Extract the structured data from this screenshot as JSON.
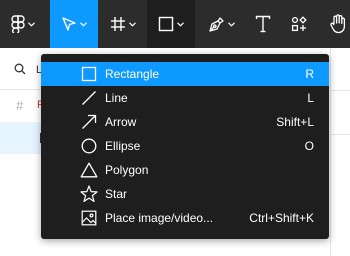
{
  "colors": {
    "toolbar_bg": "#2c2c2c",
    "selected_tool_bg": "#0d99ff",
    "pressed_tool_bg": "#1e1e1e",
    "menu_bg": "#1e1e1e",
    "menu_highlight": "#0d99ff"
  },
  "toolbar": {
    "tools": [
      {
        "icon": "figma-main-menu-icon",
        "has_dropdown": true,
        "state": "normal"
      },
      {
        "icon": "move-cursor-icon",
        "has_dropdown": true,
        "state": "selected"
      },
      {
        "icon": "frame-hash-icon",
        "has_dropdown": true,
        "state": "normal"
      },
      {
        "icon": "rectangle-shape-icon",
        "has_dropdown": true,
        "state": "pressed"
      },
      {
        "icon": "pen-tool-icon",
        "has_dropdown": true,
        "state": "normal"
      },
      {
        "icon": "text-tool-icon",
        "has_dropdown": false,
        "state": "normal"
      },
      {
        "icon": "resources-icon",
        "has_dropdown": false,
        "state": "normal"
      },
      {
        "icon": "hand-tool-icon",
        "has_dropdown": false,
        "state": "normal"
      }
    ]
  },
  "background": {
    "search_text": "L",
    "layer_initial": "F",
    "search_icon": "search-icon",
    "frame_icon": "#"
  },
  "shape_menu": {
    "items": [
      {
        "label": "Rectangle",
        "shortcut": "R",
        "icon": "rectangle-icon",
        "highlighted": true
      },
      {
        "label": "Line",
        "shortcut": "L",
        "icon": "line-icon",
        "highlighted": false
      },
      {
        "label": "Arrow",
        "shortcut": "Shift+L",
        "icon": "arrow-icon",
        "highlighted": false
      },
      {
        "label": "Ellipse",
        "shortcut": "O",
        "icon": "ellipse-icon",
        "highlighted": false
      },
      {
        "label": "Polygon",
        "shortcut": "",
        "icon": "polygon-icon",
        "highlighted": false
      },
      {
        "label": "Star",
        "shortcut": "",
        "icon": "star-icon",
        "highlighted": false
      },
      {
        "label": "Place image/video...",
        "shortcut": "Ctrl+Shift+K",
        "icon": "image-icon",
        "highlighted": false
      }
    ]
  }
}
